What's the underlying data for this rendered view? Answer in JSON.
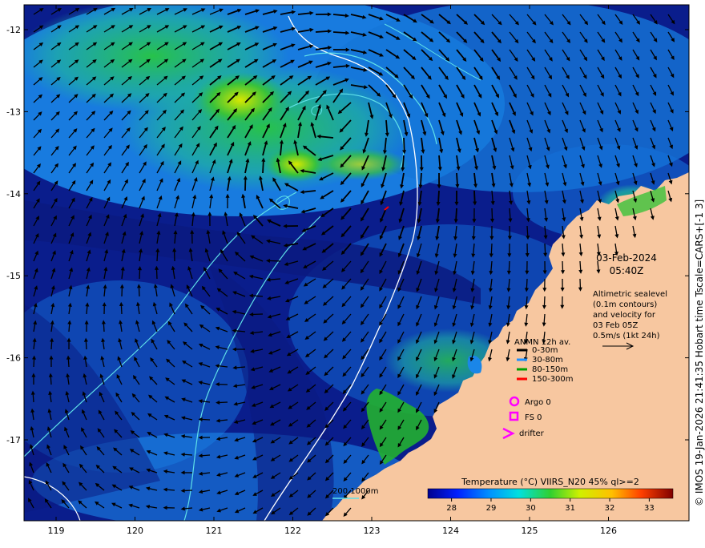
{
  "map": {
    "date": "03-Feb-2024",
    "time": "05:40Z",
    "altimetry_note": [
      "Altimetric sealevel",
      "(0.1m contours)",
      "and velocity for",
      "03 Feb 05Z",
      "0.5m/s (1kt 24h)"
    ],
    "anmn": {
      "title": "ANMN 12h av.",
      "items": [
        {
          "label": "0-30m",
          "color": "#000000"
        },
        {
          "label": "30-80m",
          "color": "#1e90ff"
        },
        {
          "label": "80-150m",
          "color": "#00a000"
        },
        {
          "label": "150-300m",
          "color": "#ff0000"
        }
      ]
    },
    "argo_label": "Argo 0",
    "fs_label": "FS 0",
    "drifter_label": "drifter",
    "marker_color": "#ff00ff",
    "bathy_label": "200  1000m",
    "colorbar": {
      "title": "Temperature (°C) VIIRS_N20 45% ql>=2",
      "ticks": [
        "28",
        "29",
        "30",
        "31",
        "32",
        "33"
      ],
      "range": [
        27.4,
        33.6
      ]
    },
    "side_text": "© IMOS 19-Jan-2026 21:41:35 Hobart time Tscale=CARS+[-1 3]",
    "x_ticks": [
      "119",
      "120",
      "121",
      "122",
      "123",
      "124",
      "125",
      "126"
    ],
    "y_ticks": [
      "-12",
      "-13",
      "-14",
      "-15",
      "-16",
      "-17"
    ],
    "land_color": "#f7c7a0",
    "sea_deep_color": "#0a1d8c"
  }
}
